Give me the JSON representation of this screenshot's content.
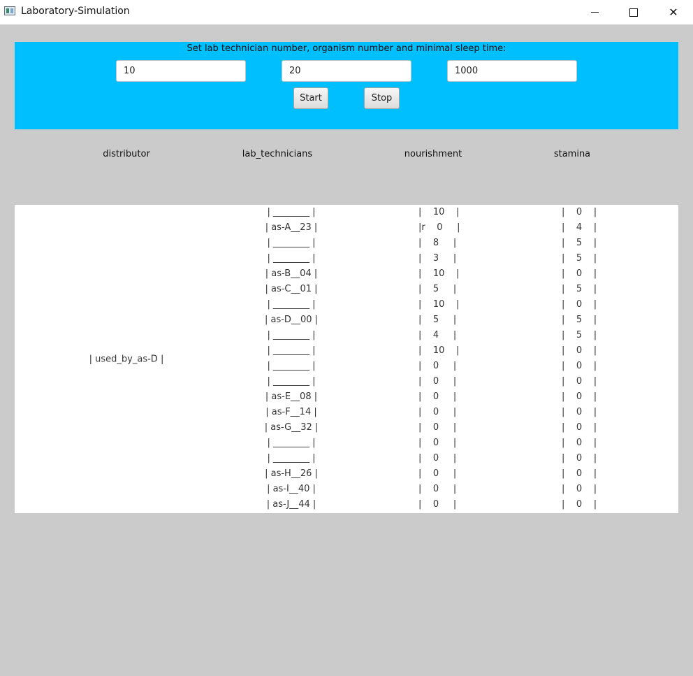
{
  "window": {
    "title": "Laboratory-Simulation",
    "minimize": "",
    "maximize": "",
    "close": "✕"
  },
  "panel": {
    "prompt": "Set lab technician number, organism number and minimal sleep time:",
    "technicians_value": "10",
    "organisms_value": "20",
    "sleep_value": "1000",
    "start_label": "Start",
    "stop_label": "Stop"
  },
  "headers": {
    "distributor": "distributor",
    "lab_technicians": "lab_technicians",
    "nourishment": "nourishment",
    "stamina": "stamina"
  },
  "distributor_value": "| used_by_as-D |",
  "rows": [
    {
      "lab": "| ________ |",
      "nour": "|    10    |",
      "stam": "|    0    |"
    },
    {
      "lab": "| as-A__23 |",
      "nour": "|r    0     |",
      "stam": "|    4    |"
    },
    {
      "lab": "| ________ |",
      "nour": "|    8     |",
      "stam": "|    5    |"
    },
    {
      "lab": "| ________ |",
      "nour": "|    3     |",
      "stam": "|    5    |"
    },
    {
      "lab": "| as-B__04 |",
      "nour": "|    10    |",
      "stam": "|    0    |"
    },
    {
      "lab": "| as-C__01 |",
      "nour": "|    5     |",
      "stam": "|    5    |"
    },
    {
      "lab": "| ________ |",
      "nour": "|    10    |",
      "stam": "|    0    |"
    },
    {
      "lab": "| as-D__00 |",
      "nour": "|    5     |",
      "stam": "|    5    |"
    },
    {
      "lab": "| ________ |",
      "nour": "|    4     |",
      "stam": "|    5    |"
    },
    {
      "lab": "| ________ |",
      "nour": "|    10    |",
      "stam": "|    0    |"
    },
    {
      "lab": "| ________ |",
      "nour": "|    0     |",
      "stam": "|    0    |"
    },
    {
      "lab": "| ________ |",
      "nour": "|    0     |",
      "stam": "|    0    |"
    },
    {
      "lab": "| as-E__08 |",
      "nour": "|    0     |",
      "stam": "|    0    |"
    },
    {
      "lab": "| as-F__14 |",
      "nour": "|    0     |",
      "stam": "|    0    |"
    },
    {
      "lab": "| as-G__32 |",
      "nour": "|    0     |",
      "stam": "|    0    |"
    },
    {
      "lab": "| ________ |",
      "nour": "|    0     |",
      "stam": "|    0    |"
    },
    {
      "lab": "| ________ |",
      "nour": "|    0     |",
      "stam": "|    0    |"
    },
    {
      "lab": "| as-H__26 |",
      "nour": "|    0     |",
      "stam": "|    0    |"
    },
    {
      "lab": "| as-I__40 |",
      "nour": "|    0     |",
      "stam": "|    0    |"
    },
    {
      "lab": "| as-J__44 |",
      "nour": "|    0     |",
      "stam": "|    0    |"
    }
  ]
}
